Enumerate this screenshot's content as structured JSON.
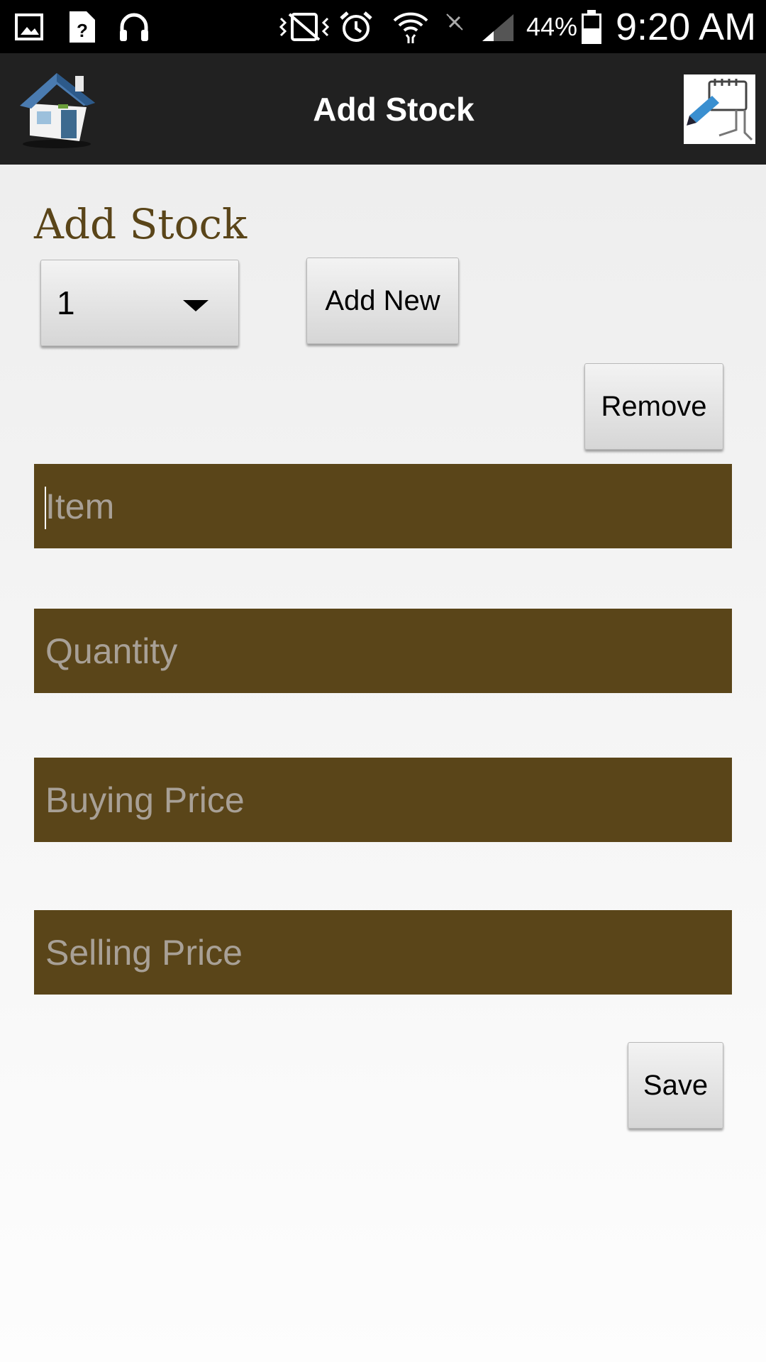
{
  "status_bar": {
    "battery": "44%",
    "time": "9:20 AM",
    "icons": [
      "gallery-icon",
      "unknown-file-icon",
      "headphones-icon",
      "vibrate-icon",
      "alarm-icon",
      "wifi-icon",
      "no-signal-icon",
      "cell-signal-icon",
      "battery-icon"
    ]
  },
  "action_bar": {
    "title": "Add Stock",
    "home_icon": "house-icon",
    "edit_icon": "edit-pencil-icon"
  },
  "form": {
    "heading": "Add Stock",
    "spinner_value": "1",
    "add_new_label": "Add New",
    "remove_label": "Remove",
    "save_label": "Save",
    "item_placeholder": "Item",
    "quantity_placeholder": "Quantity",
    "buying_price_placeholder": "Buying Price",
    "selling_price_placeholder": "Selling Price"
  },
  "colors": {
    "field_bg": "#5a4519",
    "heading": "#5a4519",
    "action_bar": "#212121"
  }
}
